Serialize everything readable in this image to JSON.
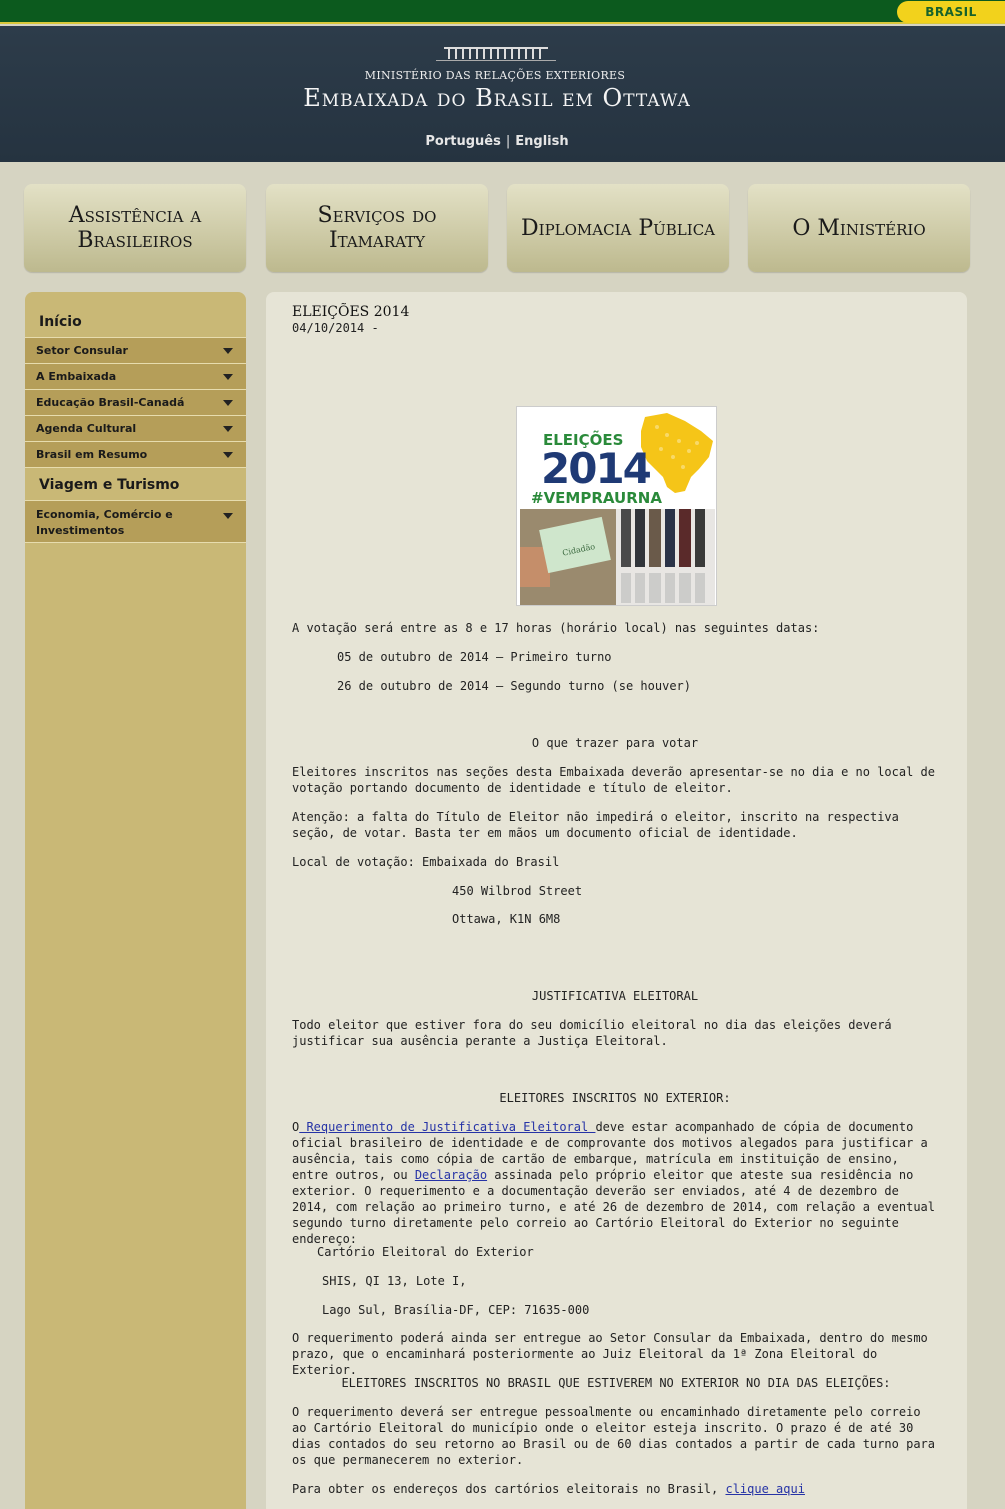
{
  "gov_bar": {
    "brand": "BRASIL"
  },
  "header": {
    "ministry": "MINISTÉRIO DAS RELAÇÕES EXTERIORES",
    "embassy": "Embaixada do Brasil em Ottawa",
    "lang_pt": "Português",
    "lang_sep": "|",
    "lang_en": "English"
  },
  "nav": {
    "assistencia": "Assistência a Brasileiros",
    "servicos": "Serviços do Itamaraty",
    "diplomacia": "Diplomacia Pública",
    "ministerio": "O Ministério"
  },
  "sidebar": {
    "inicio": "Início",
    "items": [
      {
        "label": "Setor Consular"
      },
      {
        "label": "A Embaixada"
      },
      {
        "label": "Educação Brasil-Canadá"
      },
      {
        "label": "Agenda Cultural"
      },
      {
        "label": "Brasil em Resumo"
      }
    ],
    "viagem": "Viagem e Turismo",
    "economia": "Economia, Comércio e Investimentos"
  },
  "article": {
    "title": "ELEIÇÕES 2014",
    "date": "04/10/2014 -",
    "poster": {
      "eleicoes": "ELEIÇÕES",
      "year": "2014",
      "hashtag": "#VEMPRAURNA",
      "card_label": "Cidadão"
    },
    "voting_times": "A votação será entre as 8 e 17 horas (horário local) nas seguintes datas:",
    "round1": "05 de outubro de 2014 – Primeiro turno",
    "round2": "26 de outubro de 2014 – Segundo turno (se houver)",
    "bring_heading": "O que trazer para votar",
    "bring_text": "Eleitores inscritos nas seções desta Embaixada deverão apresentar-se no dia e no local de votação portando documento de identidade e título de eleitor.",
    "attention": "Atenção: a falta do Título de Eleitor não impedirá o eleitor, inscrito na respectiva seção, de votar. Basta ter em mãos um documento oficial de identidade.",
    "location": "Local de votação: Embaixada do Brasil",
    "address1": "450 Wilbrod Street",
    "address2": "Ottawa, K1N 6M8",
    "justification_heading": "JUSTIFICATIVA ELEITORAL",
    "justification_text": "Todo eleitor que estiver fora do seu domicílio eleitoral no dia das eleições deverá justificar sua ausência perante a Justiça Eleitoral.",
    "abroad_heading": "ELEITORES INSCRITOS NO EXTERIOR:",
    "abroad_o": "O",
    "abroad_link": " Requerimento de Justificativa Eleitoral ",
    "abroad_text1": "deve estar acompanhado de cópia de documento oficial brasileiro de identidade e de comprovante dos motivos alegados para justificar a ausência, tais como cópia de cartão de embarque, matrícula em instituição de ensino, entre outros, ou ",
    "declaracao_link": "Declaração",
    "abroad_text2": " assinada pelo próprio eleitor que ateste sua residência no exterior. O requerimento e a documentação deverão ser enviados, até 4 de dezembro de 2014, com relação ao primeiro turno, e até 26 de dezembro de 2014, com relação a eventual segundo turno diretamente pelo correio ao Cartório Eleitoral do Exterior no seguinte endereço:",
    "cartorio1": "Cartório Eleitoral do Exterior",
    "cartorio2": "SHIS, QI 13, Lote I,",
    "cartorio3": "Lago Sul, Brasília-DF, CEP: 71635-000",
    "consular_text": "O requerimento poderá ainda ser entregue ao Setor Consular da Embaixada, dentro do mesmo prazo, que o encaminhará posteriormente ao Juiz Eleitoral da 1ª Zona Eleitoral do Exterior.",
    "brasil_heading": "ELEITORES INSCRITOS NO BRASIL QUE ESTIVEREM NO EXTERIOR NO DIA DAS ELEIÇÕES:",
    "brasil_text": "O requerimento deverá ser entregue pessoalmente ou encaminhado diretamente pelo correio ao Cartório Eleitoral do município onde o eleitor esteja inscrito. O prazo é de até 30 dias contados do seu retorno ao Brasil ou de 60 dias contados a partir de cada turno para os que permanecerem no exterior.",
    "addresses_text": "Para obter os endereços dos cartórios eleitorais no Brasil, ",
    "addresses_link": "clique aqui"
  }
}
